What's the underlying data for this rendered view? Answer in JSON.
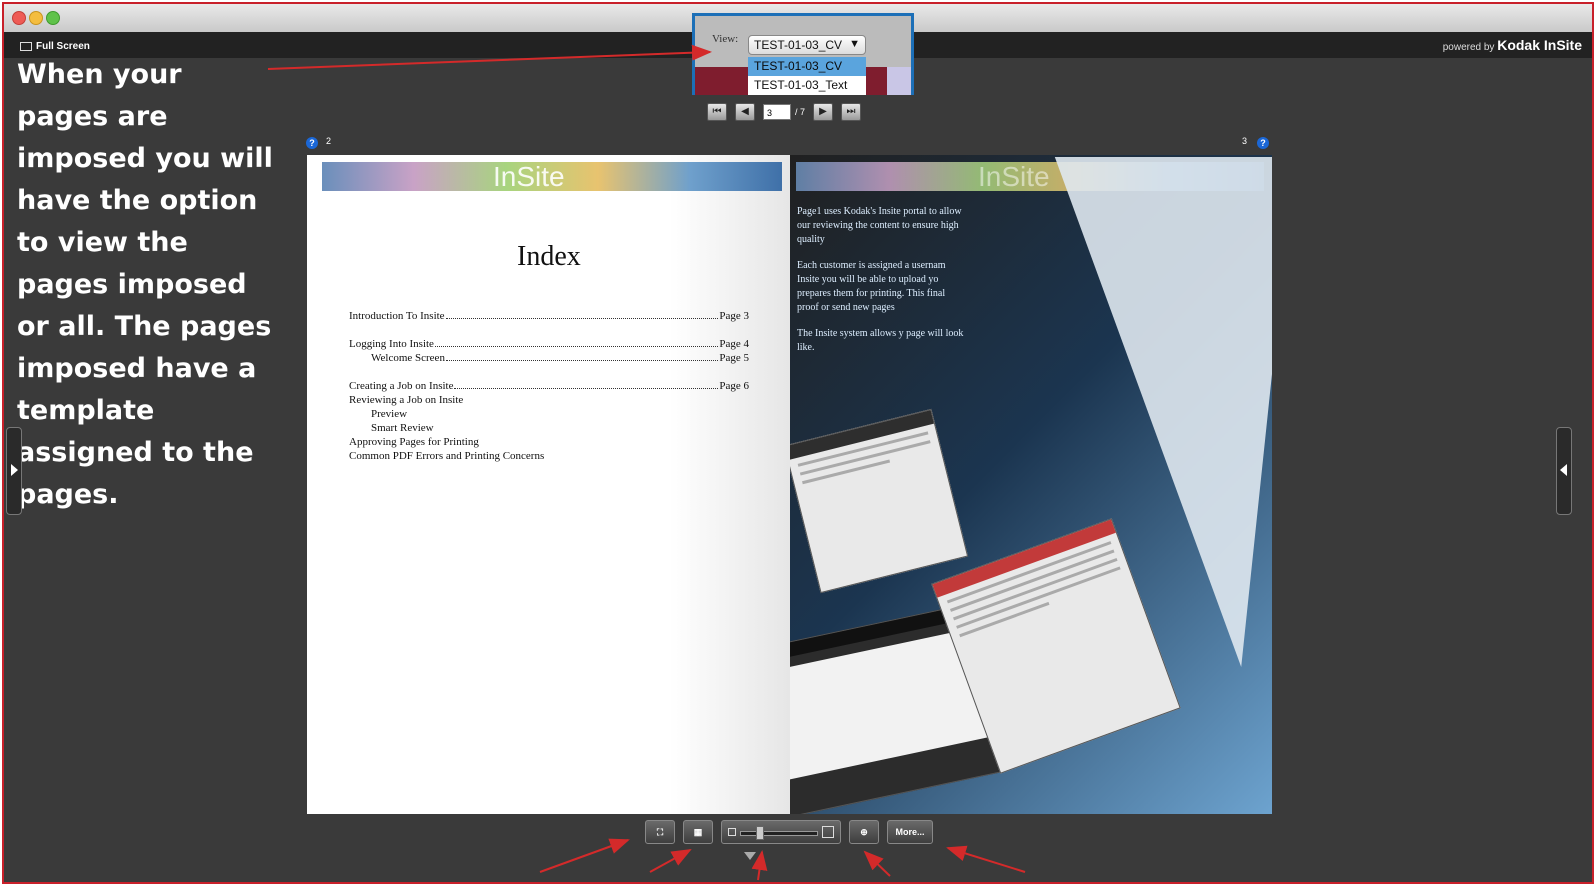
{
  "window": {
    "full_screen_label": "Full Screen",
    "powered_by": "powered by",
    "brand": "Kodak InSite"
  },
  "annotation_text": "When your pages are imposed you will have the option to view the pages imposed or all. The pages imposed have a template assigned to the pages.",
  "view": {
    "label": "View:",
    "selected": "TEST-01-03_CV",
    "options": [
      "TEST-01-03_CV",
      "TEST-01-03_Text"
    ]
  },
  "pager": {
    "current": "3",
    "total": "/ 7"
  },
  "pages": {
    "left_number": "2",
    "right_number": "3",
    "help": "?"
  },
  "left_page": {
    "banner": "InSite",
    "title": "Index",
    "toc": [
      {
        "title": "Introduction To Insite",
        "page": "Page 3",
        "indent": false,
        "dots": true,
        "gap_before": false
      },
      {
        "title": "Logging Into Insite",
        "page": "Page 4",
        "indent": false,
        "dots": true,
        "gap_before": true
      },
      {
        "title": "Welcome Screen",
        "page": "Page 5",
        "indent": true,
        "dots": true,
        "gap_before": false
      },
      {
        "title": "Creating a Job on Insite",
        "page": "Page 6",
        "indent": false,
        "dots": true,
        "gap_before": true
      },
      {
        "title": "Reviewing a Job on Insite",
        "page": "",
        "indent": false,
        "dots": false,
        "gap_before": false
      },
      {
        "title": "Preview",
        "page": "",
        "indent": true,
        "dots": false,
        "gap_before": false
      },
      {
        "title": "Smart Review",
        "page": "",
        "indent": true,
        "dots": false,
        "gap_before": false
      },
      {
        "title": "Approving Pages for Printing",
        "page": "",
        "indent": false,
        "dots": false,
        "gap_before": false
      },
      {
        "title": "Common PDF Errors and Printing Concerns",
        "page": "",
        "indent": false,
        "dots": false,
        "gap_before": false
      }
    ]
  },
  "right_page": {
    "banner": "InSite",
    "paragraphs": [
      "Page1 uses Kodak's Insite portal to allow our reviewing the content to ensure high quality",
      "Each customer is assigned a usernam Insite you will be able to upload yo prepares them for printing. This final proof or send new pages",
      "The Insite system allows y page will look like."
    ]
  },
  "toolbar": {
    "more_label": "More..."
  },
  "colors": {
    "annotation_red": "#d42a2a",
    "accent_blue": "#1c6fb7"
  }
}
